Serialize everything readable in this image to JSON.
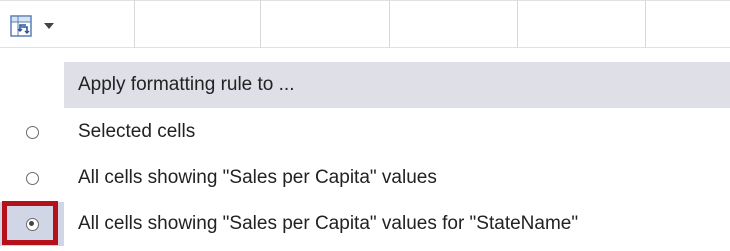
{
  "quick_button": {
    "icon": "quick-analysis-icon",
    "dropdown_icon": "chevron-down-icon"
  },
  "menu": {
    "header": "Apply formatting rule to ...",
    "options": [
      {
        "label": "Selected cells",
        "checked": false
      },
      {
        "label": "All cells showing \"Sales per Capita\" values",
        "checked": false
      },
      {
        "label": "All cells showing \"Sales per Capita\" values for \"StateName\"",
        "checked": true
      }
    ]
  },
  "colors": {
    "header_bg": "#dedfe7",
    "highlight_border": "#b4111a",
    "selected_radio_bg": "#d0d6e6"
  }
}
